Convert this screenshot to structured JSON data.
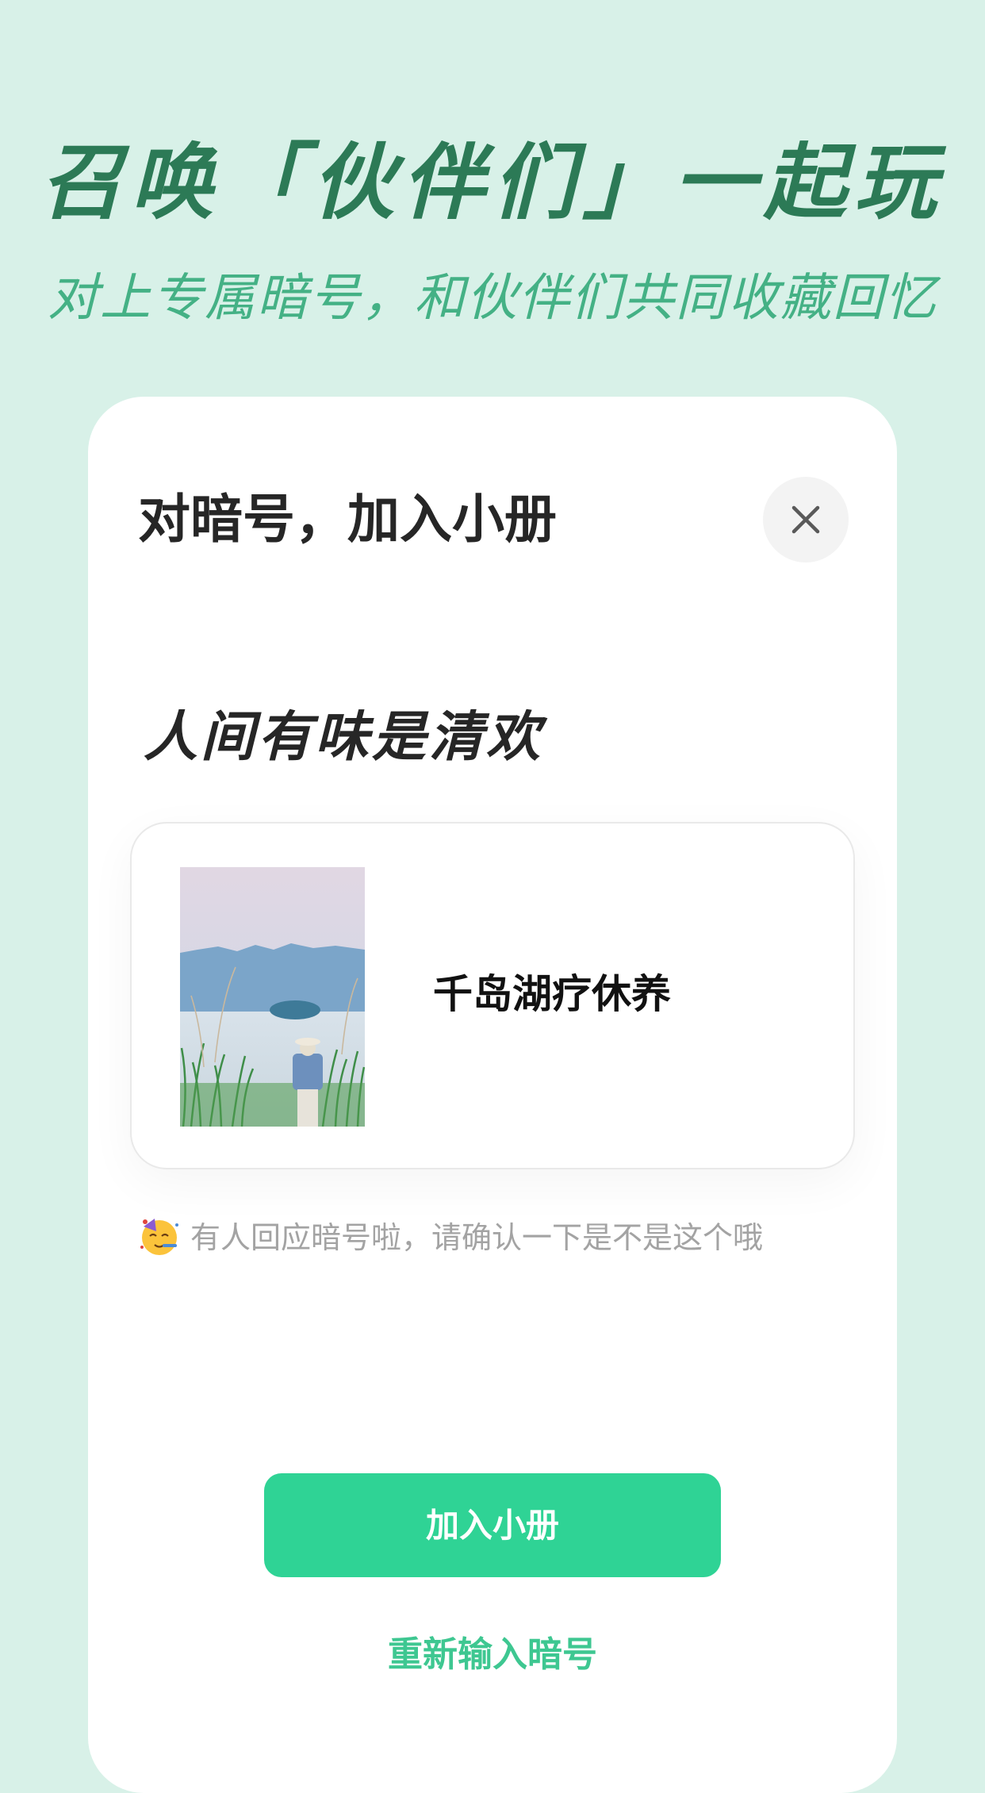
{
  "hero": {
    "title": "召唤「伙伴们」一起玩",
    "subtitle": "对上专属暗号，和伙伴们共同收藏回忆"
  },
  "dialog": {
    "title": "对暗号，加入小册",
    "close_icon": "close-icon",
    "book_name": "人间有味是清欢",
    "result_card": {
      "title": "千岛湖疗休养",
      "cover_icon": "lake-photo"
    },
    "hint": {
      "emoji": "partying-face-emoji",
      "text": "有人回应暗号啦，请确认一下是不是这个哦"
    },
    "join_label": "加入小册",
    "reenter_label": "重新输入暗号"
  },
  "colors": {
    "background": "#d8f1e8",
    "title": "#2c7a56",
    "subtitle": "#44b185",
    "accent": "#2fd395",
    "link": "#3ec791"
  }
}
